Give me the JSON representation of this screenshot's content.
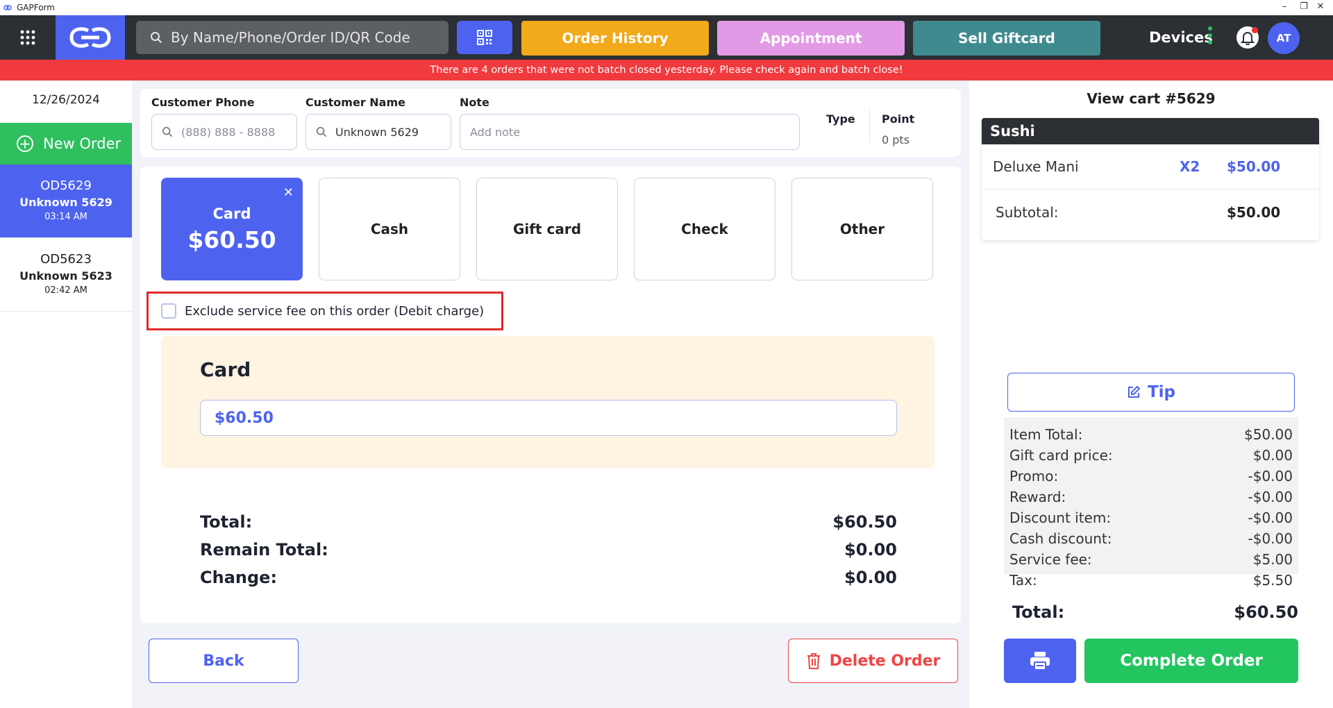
{
  "window": {
    "title": "GAPForm",
    "controls": [
      "–",
      "❐",
      "✕"
    ]
  },
  "topnav": {
    "search_placeholder": "By Name/Phone/Order ID/QR Code",
    "order_history": "Order History",
    "appointment": "Appointment",
    "sell_giftcard": "Sell Giftcard",
    "devices": "Devices",
    "avatar": "AT",
    "colors": {
      "brand": "#4d63f0",
      "history": "#f2a91a",
      "appointment": "#e29ae6",
      "giftcard": "#3f8a8f"
    }
  },
  "alert": "There are 4 orders that were not batch closed yesterday. Please check again and batch close!",
  "sidebar": {
    "date": "12/26/2024",
    "new_order": "New Order",
    "orders": [
      {
        "id": "OD5629",
        "name": "Unknown 5629",
        "time": "03:14 AM"
      },
      {
        "id": "OD5623",
        "name": "Unknown 5623",
        "time": "02:42 AM"
      }
    ]
  },
  "customer": {
    "phone_label": "Customer Phone",
    "phone_placeholder": "(888) 888 - 8888",
    "name_label": "Customer Name",
    "name_value": "Unknown 5629",
    "note_label": "Note",
    "note_placeholder": "Add note",
    "type_label": "Type",
    "point_label": "Point",
    "point_value": "0 pts"
  },
  "payment": {
    "methods": {
      "card": {
        "label": "Card",
        "amount": "$60.50"
      },
      "cash": "Cash",
      "giftcard": "Gift card",
      "check": "Check",
      "other": "Other"
    },
    "exclude_fee_label": "Exclude service fee on this order (Debit charge)",
    "card_section_title": "Card",
    "card_amount": "$60.50",
    "total_label": "Total:",
    "total_value": "$60.50",
    "remain_label": "Remain Total:",
    "remain_value": "$0.00",
    "change_label": "Change:",
    "change_value": "$0.00"
  },
  "actions": {
    "back": "Back",
    "delete": "Delete Order",
    "complete": "Complete Order",
    "tip": "Tip"
  },
  "cart": {
    "title": "View cart #5629",
    "section": "Sushi",
    "item": {
      "name": "Deluxe Mani",
      "qty": "X2",
      "price": "$50.00"
    },
    "subtotal_label": "Subtotal:",
    "subtotal_value": "$50.00"
  },
  "totals": [
    {
      "label": "Item Total:",
      "value": "$50.00"
    },
    {
      "label": "Gift card price:",
      "value": "$0.00"
    },
    {
      "label": "Promo:",
      "value": "-$0.00"
    },
    {
      "label": "Reward:",
      "value": "-$0.00"
    },
    {
      "label": "Discount item:",
      "value": "-$0.00"
    },
    {
      "label": "Cash discount:",
      "value": "-$0.00"
    },
    {
      "label": "Service fee:",
      "value": "$5.00"
    },
    {
      "label": "Tax:",
      "value": "$5.50"
    }
  ],
  "grand_total": {
    "label": "Total:",
    "value": "$60.50"
  }
}
